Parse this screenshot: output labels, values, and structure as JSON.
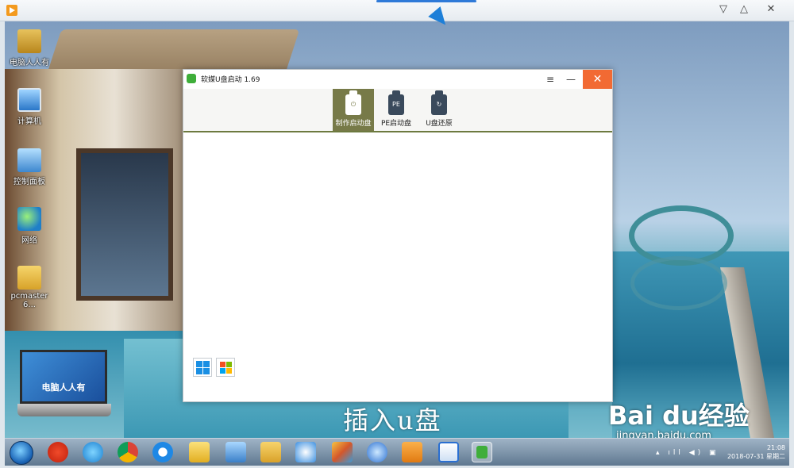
{
  "outer_window": {
    "controls": {
      "dropdown": "▽",
      "collapse": "△",
      "close": "✕"
    }
  },
  "desktop": {
    "icons": [
      {
        "label": "电脑人人有"
      },
      {
        "label": "计算机"
      },
      {
        "label": "控制面板"
      },
      {
        "label": "网络"
      },
      {
        "label": "pcmaster 6..."
      }
    ],
    "laptop_text": "电脑人人有",
    "overlay_caption": "插入u盘",
    "watermark": {
      "brand": "Bai du经验",
      "url": "jingyan.baidu.com"
    }
  },
  "app": {
    "title": "软媒U盘启动 1.69",
    "controls": {
      "menu": "≡",
      "minimize": "—",
      "close": "✕"
    },
    "tabs": [
      {
        "label": "制作启动盘",
        "icon_text": "⏻",
        "active": true
      },
      {
        "label": "PE启动盘",
        "icon_text": "PE",
        "active": false
      },
      {
        "label": "U盘还原",
        "icon_text": "↻",
        "active": false
      }
    ],
    "os_options": [
      {
        "name": "windows10-icon"
      },
      {
        "name": "windows7-icon"
      }
    ]
  },
  "taskbar": {
    "clock": {
      "time": "21:08",
      "date": "2018-07-31 星期二"
    },
    "tray_icons": "▴ ıll ◀) ▣",
    "colors": {
      "accent": "#777a48",
      "close": "#f26a33"
    }
  }
}
